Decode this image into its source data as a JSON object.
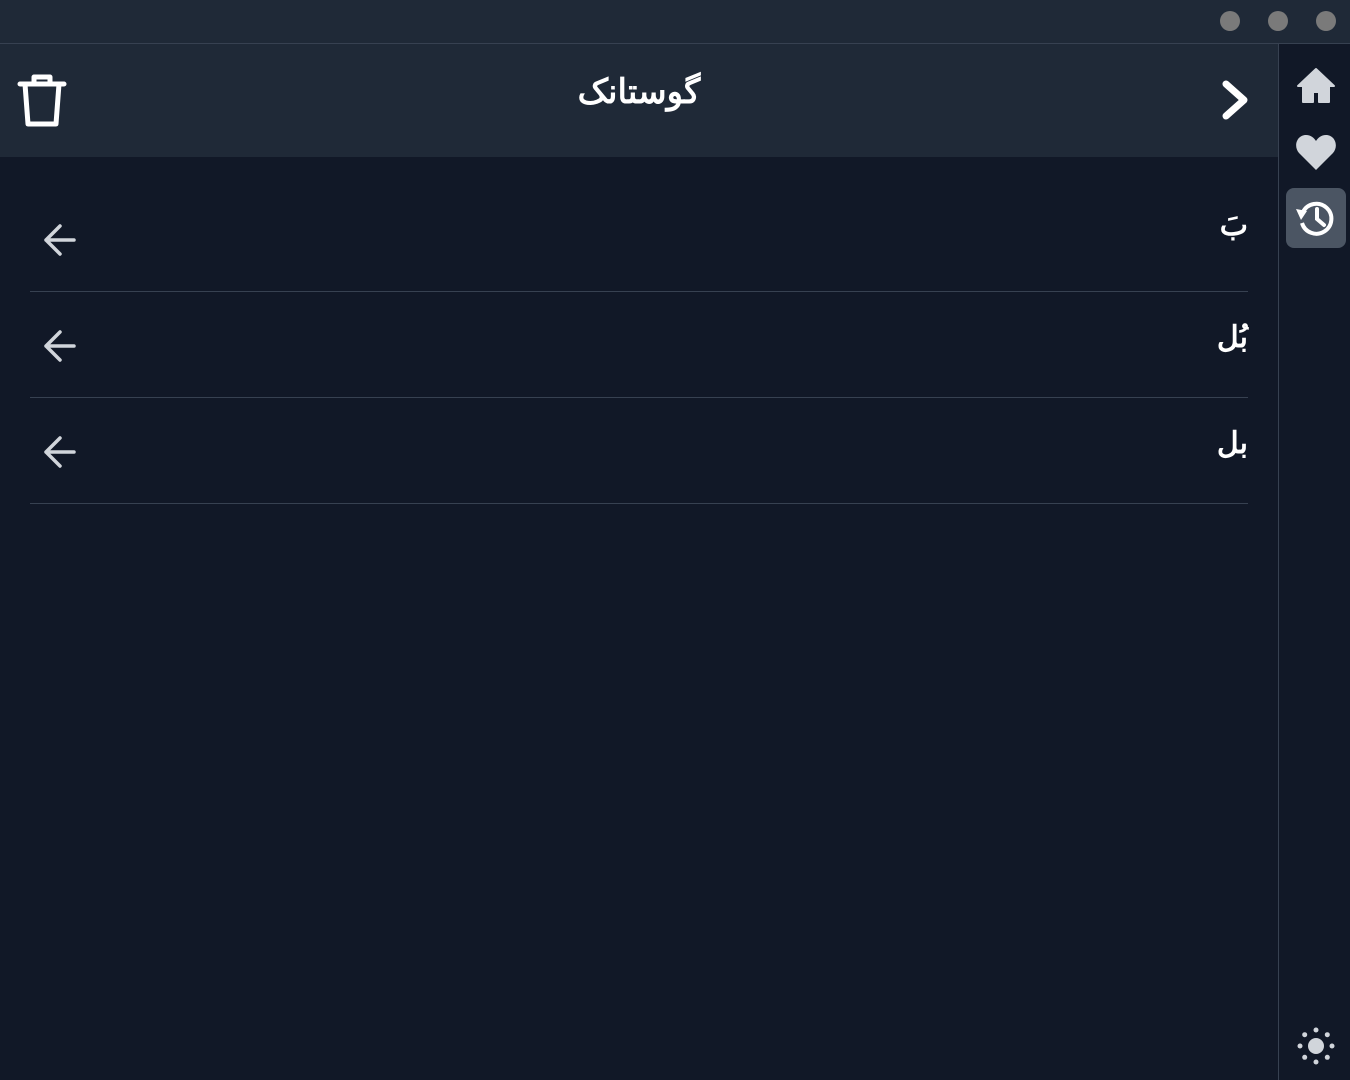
{
  "window": {
    "controls": [
      "minimize",
      "maximize",
      "close"
    ]
  },
  "header": {
    "title": "گوستانک",
    "delete_icon": "trash-icon",
    "forward_icon": "chevron-right-icon"
  },
  "sidebar": {
    "items": [
      {
        "name": "home",
        "icon": "home-icon"
      },
      {
        "name": "favorites",
        "icon": "heart-icon"
      },
      {
        "name": "history",
        "icon": "history-icon",
        "active": true
      }
    ],
    "theme_icon": "sun-icon"
  },
  "history": {
    "items": [
      {
        "word": "بَ"
      },
      {
        "word": "بُل"
      },
      {
        "word": "بل"
      }
    ]
  },
  "colors": {
    "background": "#111827",
    "header": "#1f2937",
    "active": "#4b5563",
    "icon": "#d1d5db"
  }
}
